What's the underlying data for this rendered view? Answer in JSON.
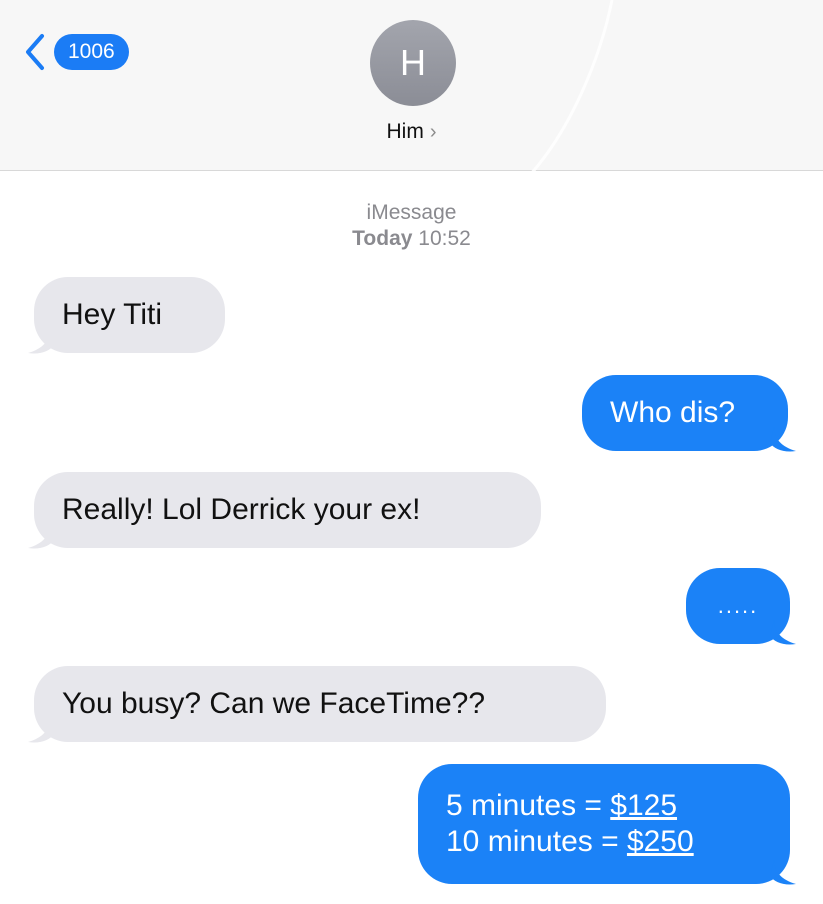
{
  "header": {
    "back_count": "1006",
    "avatar_initial": "H",
    "contact_name": "Him",
    "contact_chevron": "›"
  },
  "meta": {
    "service": "iMessage",
    "day": "Today",
    "time": "10:52"
  },
  "messages": [
    {
      "direction": "incoming",
      "text": "Hey Titi"
    },
    {
      "direction": "outgoing",
      "text": "Who dis?"
    },
    {
      "direction": "incoming",
      "text": "Really! Lol Derrick your ex!"
    },
    {
      "direction": "outgoing",
      "text": "....."
    },
    {
      "direction": "incoming",
      "text": "You busy? Can we FaceTime??"
    },
    {
      "direction": "outgoing",
      "line1_prefix": "5 minutes = ",
      "line1_price": "$125",
      "line2_prefix": "10 minutes = ",
      "line2_price": "$250"
    }
  ],
  "colors": {
    "accent": "#1b82f7",
    "incoming_bubble": "#e7e7ec",
    "header_bg": "#f7f7f7"
  }
}
